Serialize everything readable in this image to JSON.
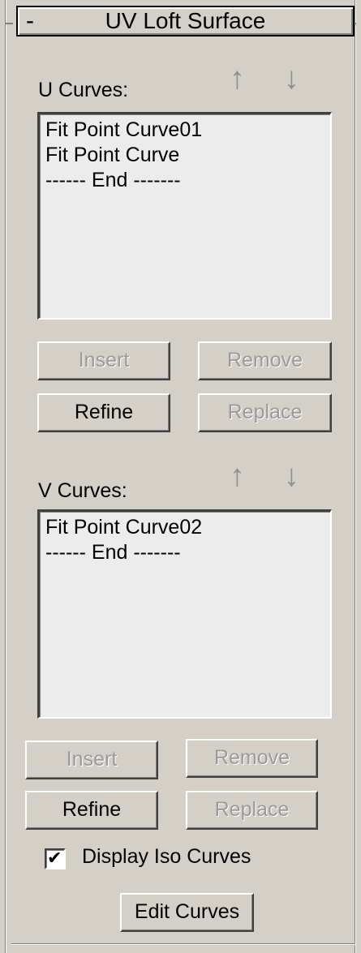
{
  "rollout": {
    "collapse_glyph": "-",
    "title": "UV Loft Surface"
  },
  "u_curves": {
    "label": "U Curves:",
    "up_arrow": "↑",
    "down_arrow": "↓",
    "items": [
      "Fit Point Curve01",
      "Fit Point Curve",
      "------ End -------"
    ],
    "insert_label": "Insert",
    "remove_label": "Remove",
    "refine_label": "Refine",
    "replace_label": "Replace"
  },
  "v_curves": {
    "label": "V Curves:",
    "up_arrow": "↑",
    "down_arrow": "↓",
    "items": [
      "Fit Point Curve02",
      "------ End -------"
    ],
    "insert_label": "Insert",
    "remove_label": "Remove",
    "refine_label": "Refine",
    "replace_label": "Replace"
  },
  "options": {
    "display_iso_curves_label": "Display Iso Curves",
    "display_iso_curves_checked": true,
    "check_glyph": "✔",
    "edit_curves_label": "Edit Curves"
  }
}
